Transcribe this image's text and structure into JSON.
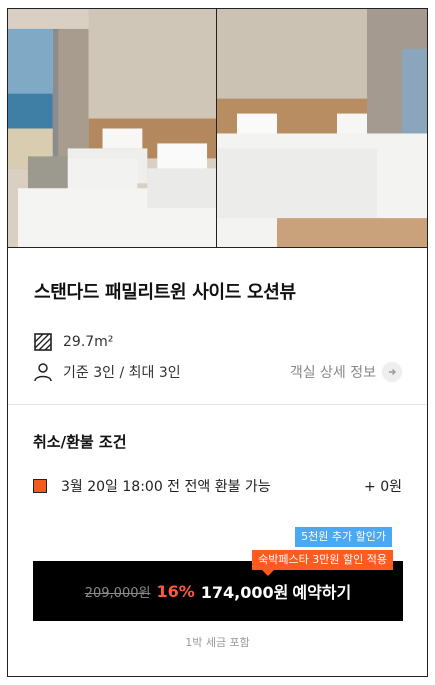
{
  "room": {
    "title": "스탠다드 패밀리트윈 사이드 오션뷰",
    "area": "29.7m²",
    "capacity": "기준 3인 / 최대 3인",
    "detail_link": "객실 상세 정보"
  },
  "refund": {
    "section_title": "취소/환불 조건",
    "condition": "3월 20일 18:00 전 전액 환불 가능",
    "fee": "+ 0원"
  },
  "badges": {
    "extra_discount": "5천원 추가 할인가",
    "festa_discount": "숙박페스타 3만원 할인 적용"
  },
  "booking": {
    "original_price": "209,000원",
    "discount_rate": "16%",
    "price": "174,000원",
    "cta": "예약하기"
  },
  "tax_note": "1박 세금 포함",
  "colors": {
    "accent_orange": "#f25a1e",
    "badge_blue": "#4aa9f2",
    "discount_red": "#ff5a3c"
  },
  "icons": {
    "area": "hatched-square-icon",
    "capacity": "person-icon",
    "detail": "chevron-right-icon",
    "refund": "orange-square-icon"
  }
}
